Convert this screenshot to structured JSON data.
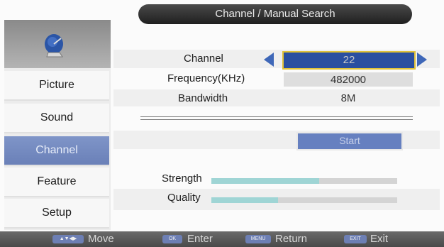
{
  "title": "Channel / Manual Search",
  "sidebar": {
    "icon": "satellite-dish-icon",
    "items": [
      {
        "label": "Picture"
      },
      {
        "label": "Sound"
      },
      {
        "label": "Channel"
      },
      {
        "label": "Feature"
      },
      {
        "label": "Setup"
      }
    ]
  },
  "fields": {
    "channel": {
      "label": "Channel",
      "value": "22"
    },
    "frequency": {
      "label": "Frequency(KHz)",
      "value": "482000"
    },
    "bandwidth": {
      "label": "Bandwidth",
      "value": "8M"
    }
  },
  "start_label": "Start",
  "meters": {
    "strength": {
      "label": "Strength",
      "level": 0.58
    },
    "quality": {
      "label": "Quality",
      "level": 0.36
    }
  },
  "footer": {
    "move": {
      "key": "▲▼◀▶",
      "label": "Move"
    },
    "enter": {
      "key": "OK",
      "label": "Enter"
    },
    "return": {
      "key": "MENU",
      "label": "Return"
    },
    "exit": {
      "key": "EXIT",
      "label": "Exit"
    }
  },
  "colors": {
    "accent": "#2a4fa0",
    "highlight": "#e0c238",
    "menu_active": "#7389c0"
  }
}
